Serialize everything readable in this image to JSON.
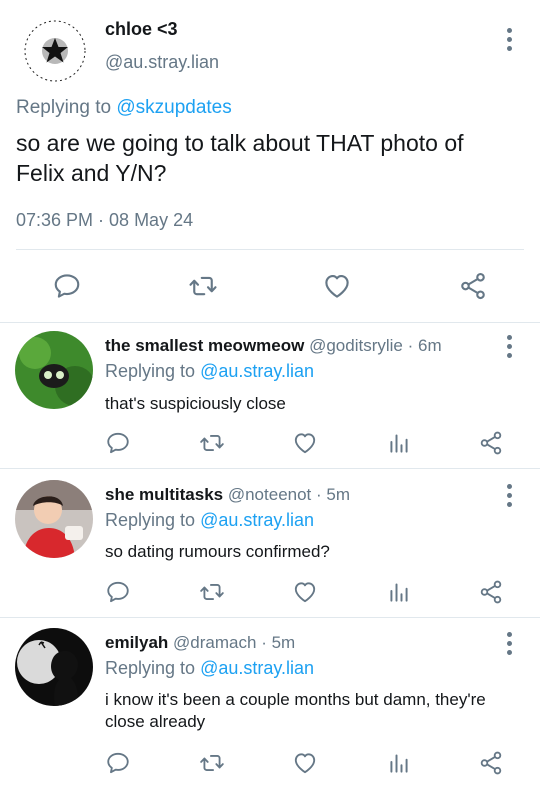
{
  "main_tweet": {
    "display_name": "chloe <3",
    "handle": "@au.stray.lian",
    "reply_prefix": "Replying to",
    "reply_to": "@skzupdates",
    "text": "so are we going to talk about THAT  photo of Felix and Y/N?",
    "timestamp": "07:36 PM · 08 May 24",
    "avatar_icon": "star-seal-avatar-icon"
  },
  "replies": [
    {
      "display_name": "the smallest meowmeow",
      "handle": "@goditsrylie",
      "time": "· 6m",
      "reply_prefix": "Replying to",
      "reply_to": "@au.stray.lian",
      "text": "that's suspiciously close",
      "avatar_icon": "green-frog-avatar-icon"
    },
    {
      "display_name": "she multitasks",
      "handle": "@noteenot",
      "time": "· 5m",
      "reply_prefix": "Replying to",
      "reply_to": "@au.stray.lian",
      "text": "so dating rumours confirmed?",
      "avatar_icon": "child-photo-avatar-icon"
    },
    {
      "display_name": "emilyah",
      "handle": "@dramach",
      "time": "· 5m",
      "reply_prefix": "Replying to",
      "reply_to": "@au.stray.lian",
      "text": "i know it's been a couple months but damn, they're close already",
      "avatar_icon": "silhouette-avatar-icon"
    }
  ],
  "colors": {
    "accent": "#1da1f2",
    "muted": "#657786",
    "text": "#14171a",
    "divider": "#e1e8ed"
  }
}
